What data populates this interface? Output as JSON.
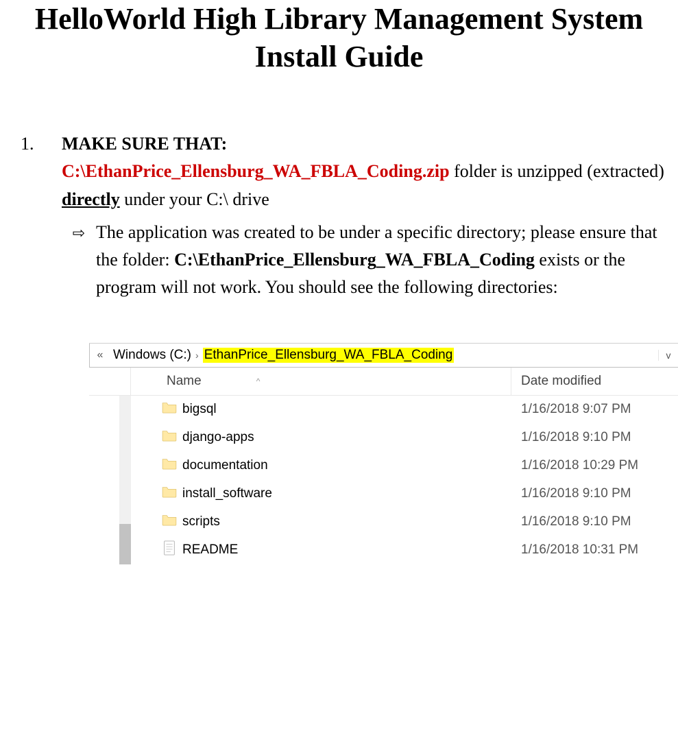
{
  "title": "HelloWorld High Library Management System Install Guide",
  "step1": {
    "number": "1.",
    "heading": "MAKE SURE THAT:",
    "zip_path": "C:\\EthanPrice_Ellensburg_WA_FBLA_Coding.zip",
    "text_after_zip_1": " folder is unzipped (extracted) ",
    "directly": "directly",
    "text_after_zip_2": " under your C:\\ drive",
    "sub1_a": "The application was created to be under a specific directory; please ensure that the folder: ",
    "sub1_path": "C:\\EthanPrice_Ellensburg_WA_FBLA_Coding",
    "sub1_b": " exists or the program will not work.  You should see the following directories:"
  },
  "explorer": {
    "prefix": "«",
    "drive": "Windows (C:)",
    "sep": "›",
    "folder": "EthanPrice_Ellensburg_WA_FBLA_Coding",
    "dropdown": "v",
    "col_name": "Name",
    "col_sort": "^",
    "col_date": "Date modified",
    "rows": [
      {
        "type": "folder",
        "name": "bigsql",
        "date": "1/16/2018 9:07 PM"
      },
      {
        "type": "folder",
        "name": "django-apps",
        "date": "1/16/2018 9:10 PM"
      },
      {
        "type": "folder",
        "name": "documentation",
        "date": "1/16/2018 10:29 PM"
      },
      {
        "type": "folder",
        "name": "install_software",
        "date": "1/16/2018 9:10 PM"
      },
      {
        "type": "folder",
        "name": "scripts",
        "date": "1/16/2018 9:10 PM"
      },
      {
        "type": "file",
        "name": "README",
        "date": "1/16/2018 10:31 PM"
      }
    ]
  }
}
